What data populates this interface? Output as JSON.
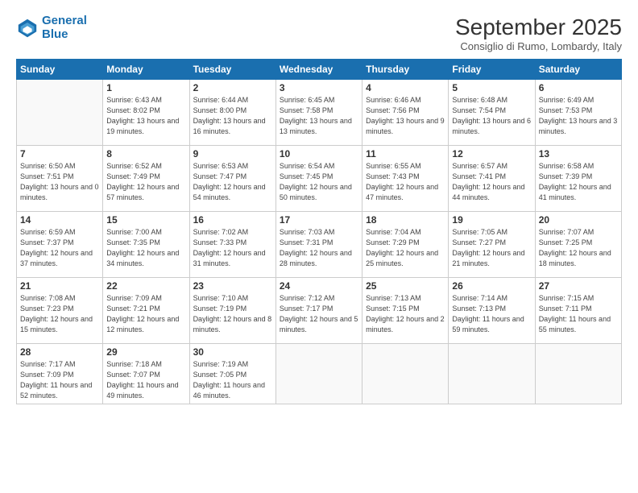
{
  "logo": {
    "line1": "General",
    "line2": "Blue"
  },
  "title": "September 2025",
  "subtitle": "Consiglio di Rumo, Lombardy, Italy",
  "days_header": [
    "Sunday",
    "Monday",
    "Tuesday",
    "Wednesday",
    "Thursday",
    "Friday",
    "Saturday"
  ],
  "weeks": [
    [
      {
        "num": "",
        "sunrise": "",
        "sunset": "",
        "daylight": ""
      },
      {
        "num": "1",
        "sunrise": "Sunrise: 6:43 AM",
        "sunset": "Sunset: 8:02 PM",
        "daylight": "Daylight: 13 hours and 19 minutes."
      },
      {
        "num": "2",
        "sunrise": "Sunrise: 6:44 AM",
        "sunset": "Sunset: 8:00 PM",
        "daylight": "Daylight: 13 hours and 16 minutes."
      },
      {
        "num": "3",
        "sunrise": "Sunrise: 6:45 AM",
        "sunset": "Sunset: 7:58 PM",
        "daylight": "Daylight: 13 hours and 13 minutes."
      },
      {
        "num": "4",
        "sunrise": "Sunrise: 6:46 AM",
        "sunset": "Sunset: 7:56 PM",
        "daylight": "Daylight: 13 hours and 9 minutes."
      },
      {
        "num": "5",
        "sunrise": "Sunrise: 6:48 AM",
        "sunset": "Sunset: 7:54 PM",
        "daylight": "Daylight: 13 hours and 6 minutes."
      },
      {
        "num": "6",
        "sunrise": "Sunrise: 6:49 AM",
        "sunset": "Sunset: 7:53 PM",
        "daylight": "Daylight: 13 hours and 3 minutes."
      }
    ],
    [
      {
        "num": "7",
        "sunrise": "Sunrise: 6:50 AM",
        "sunset": "Sunset: 7:51 PM",
        "daylight": "Daylight: 13 hours and 0 minutes."
      },
      {
        "num": "8",
        "sunrise": "Sunrise: 6:52 AM",
        "sunset": "Sunset: 7:49 PM",
        "daylight": "Daylight: 12 hours and 57 minutes."
      },
      {
        "num": "9",
        "sunrise": "Sunrise: 6:53 AM",
        "sunset": "Sunset: 7:47 PM",
        "daylight": "Daylight: 12 hours and 54 minutes."
      },
      {
        "num": "10",
        "sunrise": "Sunrise: 6:54 AM",
        "sunset": "Sunset: 7:45 PM",
        "daylight": "Daylight: 12 hours and 50 minutes."
      },
      {
        "num": "11",
        "sunrise": "Sunrise: 6:55 AM",
        "sunset": "Sunset: 7:43 PM",
        "daylight": "Daylight: 12 hours and 47 minutes."
      },
      {
        "num": "12",
        "sunrise": "Sunrise: 6:57 AM",
        "sunset": "Sunset: 7:41 PM",
        "daylight": "Daylight: 12 hours and 44 minutes."
      },
      {
        "num": "13",
        "sunrise": "Sunrise: 6:58 AM",
        "sunset": "Sunset: 7:39 PM",
        "daylight": "Daylight: 12 hours and 41 minutes."
      }
    ],
    [
      {
        "num": "14",
        "sunrise": "Sunrise: 6:59 AM",
        "sunset": "Sunset: 7:37 PM",
        "daylight": "Daylight: 12 hours and 37 minutes."
      },
      {
        "num": "15",
        "sunrise": "Sunrise: 7:00 AM",
        "sunset": "Sunset: 7:35 PM",
        "daylight": "Daylight: 12 hours and 34 minutes."
      },
      {
        "num": "16",
        "sunrise": "Sunrise: 7:02 AM",
        "sunset": "Sunset: 7:33 PM",
        "daylight": "Daylight: 12 hours and 31 minutes."
      },
      {
        "num": "17",
        "sunrise": "Sunrise: 7:03 AM",
        "sunset": "Sunset: 7:31 PM",
        "daylight": "Daylight: 12 hours and 28 minutes."
      },
      {
        "num": "18",
        "sunrise": "Sunrise: 7:04 AM",
        "sunset": "Sunset: 7:29 PM",
        "daylight": "Daylight: 12 hours and 25 minutes."
      },
      {
        "num": "19",
        "sunrise": "Sunrise: 7:05 AM",
        "sunset": "Sunset: 7:27 PM",
        "daylight": "Daylight: 12 hours and 21 minutes."
      },
      {
        "num": "20",
        "sunrise": "Sunrise: 7:07 AM",
        "sunset": "Sunset: 7:25 PM",
        "daylight": "Daylight: 12 hours and 18 minutes."
      }
    ],
    [
      {
        "num": "21",
        "sunrise": "Sunrise: 7:08 AM",
        "sunset": "Sunset: 7:23 PM",
        "daylight": "Daylight: 12 hours and 15 minutes."
      },
      {
        "num": "22",
        "sunrise": "Sunrise: 7:09 AM",
        "sunset": "Sunset: 7:21 PM",
        "daylight": "Daylight: 12 hours and 12 minutes."
      },
      {
        "num": "23",
        "sunrise": "Sunrise: 7:10 AM",
        "sunset": "Sunset: 7:19 PM",
        "daylight": "Daylight: 12 hours and 8 minutes."
      },
      {
        "num": "24",
        "sunrise": "Sunrise: 7:12 AM",
        "sunset": "Sunset: 7:17 PM",
        "daylight": "Daylight: 12 hours and 5 minutes."
      },
      {
        "num": "25",
        "sunrise": "Sunrise: 7:13 AM",
        "sunset": "Sunset: 7:15 PM",
        "daylight": "Daylight: 12 hours and 2 minutes."
      },
      {
        "num": "26",
        "sunrise": "Sunrise: 7:14 AM",
        "sunset": "Sunset: 7:13 PM",
        "daylight": "Daylight: 11 hours and 59 minutes."
      },
      {
        "num": "27",
        "sunrise": "Sunrise: 7:15 AM",
        "sunset": "Sunset: 7:11 PM",
        "daylight": "Daylight: 11 hours and 55 minutes."
      }
    ],
    [
      {
        "num": "28",
        "sunrise": "Sunrise: 7:17 AM",
        "sunset": "Sunset: 7:09 PM",
        "daylight": "Daylight: 11 hours and 52 minutes."
      },
      {
        "num": "29",
        "sunrise": "Sunrise: 7:18 AM",
        "sunset": "Sunset: 7:07 PM",
        "daylight": "Daylight: 11 hours and 49 minutes."
      },
      {
        "num": "30",
        "sunrise": "Sunrise: 7:19 AM",
        "sunset": "Sunset: 7:05 PM",
        "daylight": "Daylight: 11 hours and 46 minutes."
      },
      {
        "num": "",
        "sunrise": "",
        "sunset": "",
        "daylight": ""
      },
      {
        "num": "",
        "sunrise": "",
        "sunset": "",
        "daylight": ""
      },
      {
        "num": "",
        "sunrise": "",
        "sunset": "",
        "daylight": ""
      },
      {
        "num": "",
        "sunrise": "",
        "sunset": "",
        "daylight": ""
      }
    ]
  ]
}
